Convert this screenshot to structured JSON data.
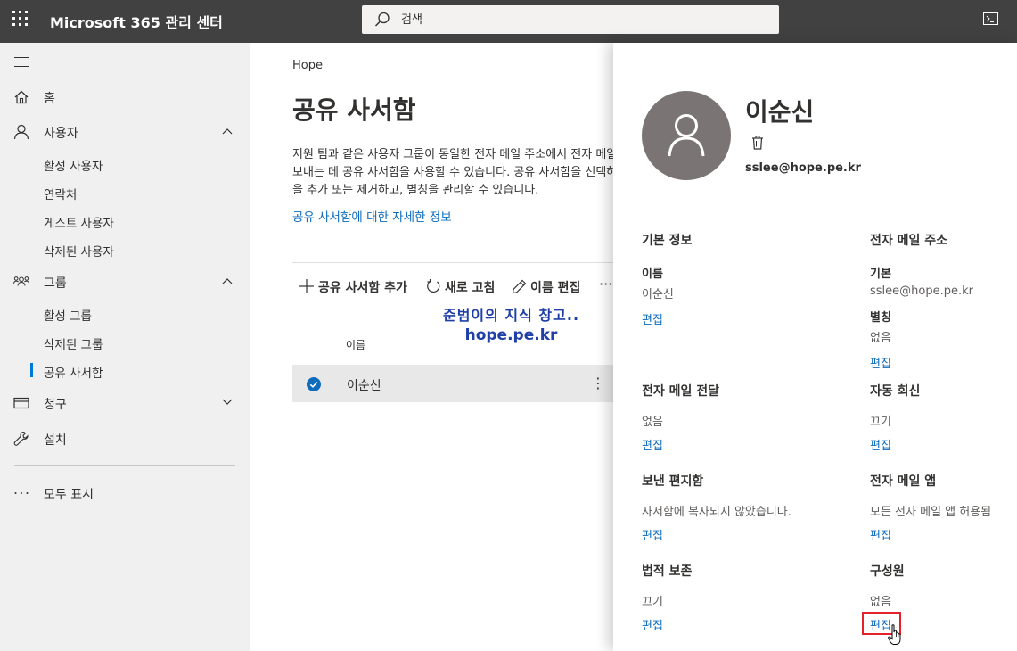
{
  "app": {
    "title": "Microsoft 365 관리 센터"
  },
  "search": {
    "placeholder": "검색"
  },
  "nav": {
    "home": "홈",
    "users": {
      "label": "사용자",
      "items": [
        "활성 사용자",
        "연락처",
        "게스트 사용자",
        "삭제된 사용자"
      ]
    },
    "groups": {
      "label": "그룹",
      "items": [
        "활성 그룹",
        "삭제된 그룹",
        "공유 사서함"
      ]
    },
    "billing": "청구",
    "setup": "설치",
    "show_all": "모두 표시"
  },
  "main": {
    "breadcrumb": "Hope",
    "title": "공유 사서함",
    "description": "지원 팀과 같은 사용자 그룹이 동일한 전자 메일 주소에서 전자 메일을 읽고 보내는 데 공유 사서함을 사용할 수 있습니다. 공유 사서함을 선택하여 구성원을 추가 또는 제거하고, 별칭을 관리할 수 있습니다.",
    "learn_more": "공유 사서함에 대한 자세한 정보",
    "toolbar": {
      "add": "공유 사서함 추가",
      "refresh": "새로 고침",
      "rename": "이름 편집",
      "more": "···"
    },
    "column_name": "이름",
    "rows": [
      {
        "name": "이순신",
        "selected": true
      }
    ]
  },
  "watermark": {
    "line1": "준범이의 지식 창고..",
    "line2": "hope.pe.kr"
  },
  "panel": {
    "user_name": "이순신",
    "email": "sslee@hope.pe.kr",
    "edit": "편집",
    "basic": {
      "title": "기본 정보",
      "name_label": "이름",
      "name_value": "이순신"
    },
    "email_addr": {
      "title": "전자 메일 주소",
      "primary_label": "기본",
      "primary_value": "sslee@hope.pe.kr",
      "alias_label": "별칭",
      "alias_value": "없음"
    },
    "forwarding": {
      "title": "전자 메일 전달",
      "value": "없음"
    },
    "auto_reply": {
      "title": "자동 회신",
      "value": "끄기"
    },
    "sent_items": {
      "title": "보낸 편지함",
      "value": "사서함에 복사되지 않았습니다."
    },
    "email_apps": {
      "title": "전자 메일 앱",
      "value": "모든 전자 메일 앱 허용됨"
    },
    "litigation": {
      "title": "법적 보존",
      "value": "끄기"
    },
    "members": {
      "title": "구성원",
      "value": "없음"
    }
  },
  "colors": {
    "topbar": "#414141",
    "nav_bg": "#f0f0f0",
    "accent": "#0078d4",
    "link": "#0f6cbd",
    "highlight": "#e3222b"
  }
}
